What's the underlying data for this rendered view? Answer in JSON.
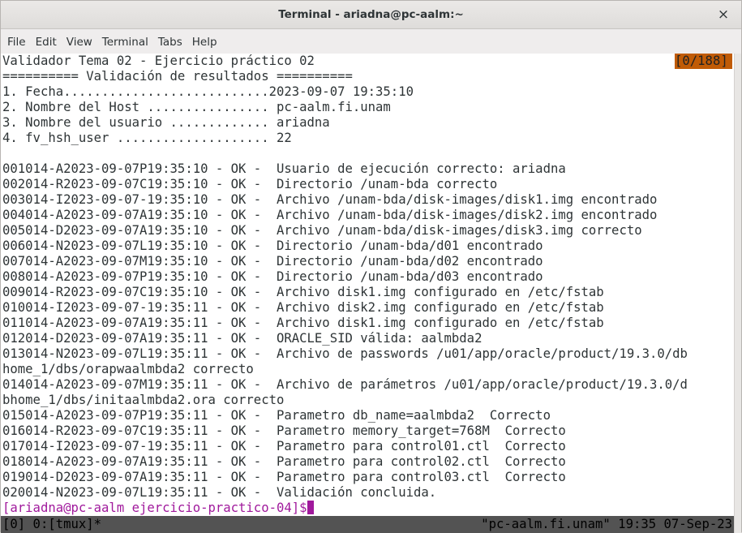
{
  "window": {
    "title": "Terminal - ariadna@pc-aalm:~",
    "close_glyph": "×"
  },
  "menu": [
    "File",
    "Edit",
    "View",
    "Terminal",
    "Tabs",
    "Help"
  ],
  "terminal": {
    "header": "Validador Tema 02 - Ejercicio práctico 02",
    "counter": "[0/188]",
    "lines": [
      "========== Validación de resultados ==========",
      "1. Fecha...........................2023-09-07 19:35:10",
      "2. Nombre del Host ................ pc-aalm.fi.unam",
      "3. Nombre del usuario ............. ariadna",
      "4. fv_hsh_user .................... 22",
      "",
      "001014-A2023-09-07P19:35:10 - OK -  Usuario de ejecución correcto: ariadna",
      "002014-R2023-09-07C19:35:10 - OK -  Directorio /unam-bda correcto",
      "003014-I2023-09-07-19:35:10 - OK -  Archivo /unam-bda/disk-images/disk1.img encontrado",
      "004014-A2023-09-07A19:35:10 - OK -  Archivo /unam-bda/disk-images/disk2.img encontrado",
      "005014-D2023-09-07A19:35:10 - OK -  Archivo /unam-bda/disk-images/disk3.img correcto",
      "006014-N2023-09-07L19:35:10 - OK -  Directorio /unam-bda/d01 encontrado",
      "007014-A2023-09-07M19:35:10 - OK -  Directorio /unam-bda/d02 encontrado",
      "008014-A2023-09-07P19:35:10 - OK -  Directorio /unam-bda/d03 encontrado",
      "009014-R2023-09-07C19:35:10 - OK -  Archivo disk1.img configurado en /etc/fstab",
      "010014-I2023-09-07-19:35:11 - OK -  Archivo disk2.img configurado en /etc/fstab",
      "011014-A2023-09-07A19:35:11 - OK -  Archivo disk1.img configurado en /etc/fstab",
      "012014-D2023-09-07A19:35:11 - OK -  ORACLE_SID válida: aalmbda2",
      "013014-N2023-09-07L19:35:11 - OK -  Archivo de passwords /u01/app/oracle/product/19.3.0/db",
      "home_1/dbs/orapwaalmbda2 correcto",
      "014014-A2023-09-07M19:35:11 - OK -  Archivo de parámetros /u01/app/oracle/product/19.3.0/d",
      "bhome_1/dbs/initaalmbda2.ora correcto",
      "015014-A2023-09-07P19:35:11 - OK -  Parametro db_name=aalmbda2  Correcto",
      "016014-R2023-09-07C19:35:11 - OK -  Parametro memory_target=768M  Correcto",
      "017014-I2023-09-07-19:35:11 - OK -  Parametro para control01.ctl  Correcto",
      "018014-A2023-09-07A19:35:11 - OK -  Parametro para control02.ctl  Correcto",
      "019014-D2023-09-07A19:35:11 - OK -  Parametro para control03.ctl  Correcto",
      "020014-N2023-09-07L19:35:11 - OK -  Validación concluida."
    ],
    "prompt": "[ariadna@pc-aalm ejercicio-practico-04]$"
  },
  "tmux": {
    "left": "[0] 0:[tmux]*",
    "right": "\"pc-aalm.fi.unam\" 19:35 07-Sep-23"
  },
  "colors": {
    "prompt": "#a0199c",
    "counter_bg": "#c05b06",
    "status_bg": "#535353"
  }
}
